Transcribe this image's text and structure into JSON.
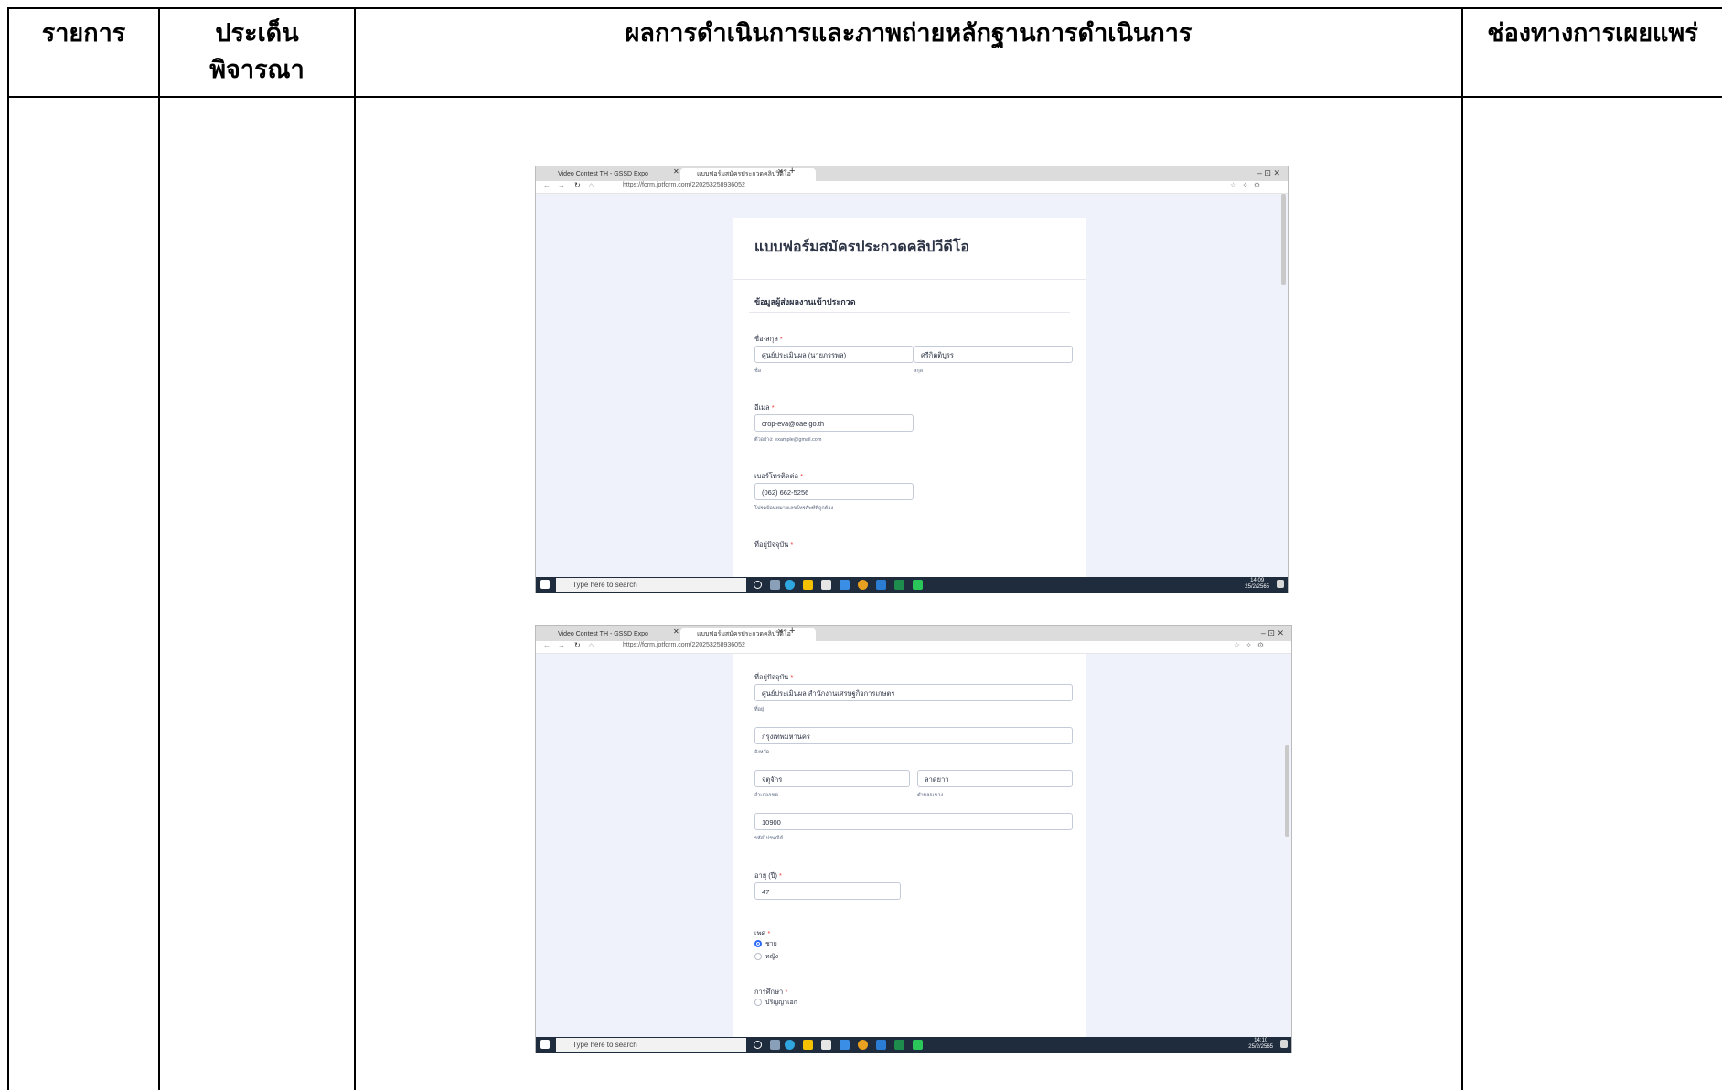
{
  "table": {
    "headers": [
      "รายการ",
      "ประเด็น\nพิจารณา",
      "ผลการดำเนินการและภาพถ่ายหลักฐานการดำเนินการ",
      "ช่องทางการเผยแพร่"
    ]
  },
  "browser": {
    "tab1": "Video Contest TH - GSSD Expo",
    "tab2": "แบบฟอร์มสมัครประกวดคลิปวิดีโอ",
    "new_tab": "+",
    "url": "https://form.jotform.com/220253258936052",
    "win_controls": "–   ⊡   ✕"
  },
  "taskbar": {
    "search_placeholder": "Type here to search",
    "clock1": "14:09\n25/2/2565",
    "clock2": "14:10\n25/2/2565"
  },
  "form1": {
    "title": "แบบฟอร์มสมัครประกวดคลิปวีดีโอ",
    "section": "ข้อมูลผู้ส่งผลงานเข้าประกวด",
    "name_label": "ชื่อ-สกุล",
    "first_name": "ศูนย์ประเมินผล (นายภรรพล)",
    "last_name": "ศรีกิตติบูรร",
    "first_hint": "ชื่อ",
    "last_hint": "สกุล",
    "email_label": "อีเมล",
    "email": "crop-eva@oae.go.th",
    "email_hint": "ตัวอย่าง: example@gmail.com",
    "phone_label": "เบอร์โทรติดต่อ",
    "phone": "(062) 662-5256",
    "phone_hint": "โปรดป้อนหมายเลขโทรศัพท์ที่ถูกต้อง",
    "addr_label": "ที่อยู่ปัจจุบัน",
    "req": "*"
  },
  "form2": {
    "addr_label": "ที่อยู่ปัจจุบัน",
    "addr1": "ศูนย์ประเมินผล สำนักงานเศรษฐกิจการเกษตร",
    "addr1_hint": "ที่อยู่",
    "province": "กรุงเทพมหานคร",
    "province_hint": "จังหวัด",
    "district": "จตุจักร",
    "district_hint": "อำเภอ/เขต",
    "subdistrict": "ลาดยาว",
    "subdistrict_hint": "ตำบล/แขวง",
    "zip": "10900",
    "zip_hint": "รหัสไปรษณีย์",
    "age_label": "อายุ (ปี)",
    "age": "47",
    "gender_label": "เพศ",
    "gender_options": [
      "ชาย",
      "หญิง"
    ],
    "edu_label": "การศึกษา",
    "edu_first_option": "ปริญญาเอก",
    "req": "*"
  },
  "colors": {
    "taskbar": "#1f2c3d",
    "form_bg": "#f0f2fb",
    "accent": "#2e69ff",
    "required": "#f23a3c"
  }
}
